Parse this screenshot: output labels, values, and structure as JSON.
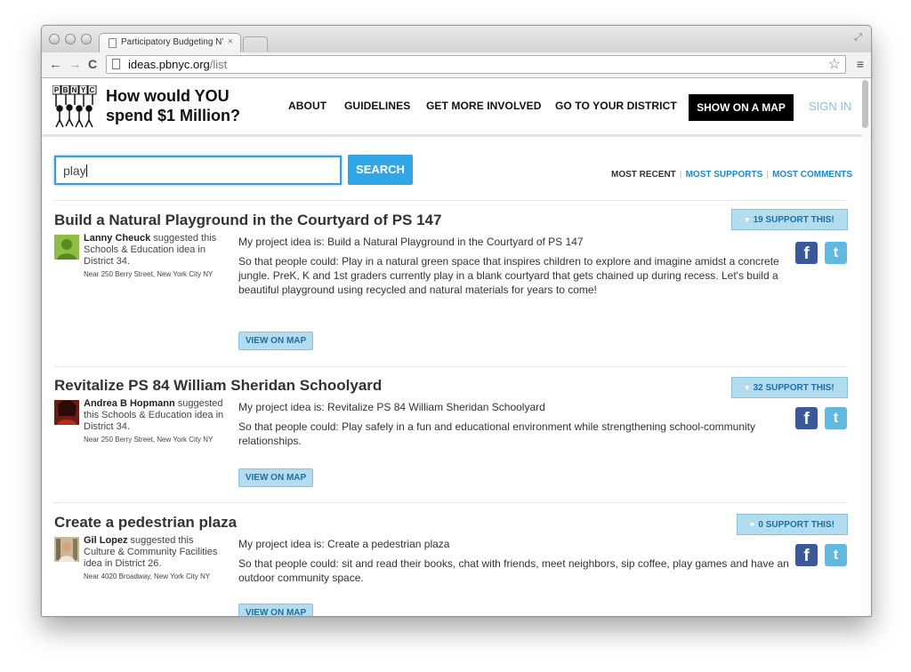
{
  "browser": {
    "tab_title": "Participatory Budgeting NY",
    "tab_close": "×",
    "url_host": "ideas.pbnyc.org",
    "url_path": "/list",
    "back": "←",
    "forward": "→",
    "reload": "C",
    "star": "☆",
    "menu": "≡"
  },
  "header": {
    "logo_letters": [
      "P",
      "B",
      "N",
      "Y",
      "C"
    ],
    "tagline": "How would YOU spend $1 Million?",
    "nav": [
      "ABOUT",
      "GUIDELINES",
      "GET MORE INVOLVED",
      "GO TO YOUR DISTRICT"
    ],
    "map_button": "SHOW ON A MAP",
    "sign_in": "SIGN IN"
  },
  "search": {
    "value": "play",
    "button": "SEARCH"
  },
  "sort": {
    "options": [
      "MOST RECENT",
      "MOST SUPPORTS",
      "MOST COMMENTS"
    ],
    "active": "MOST RECENT"
  },
  "ideas": [
    {
      "title": "Build a Natural Playground in the Courtyard of PS 147",
      "support": "19 SUPPORT THIS!",
      "author": "Lanny Cheuck",
      "category_text": " suggested this Schools & Education idea in District 34.",
      "address": "Near 250 Berry Street, New York City NY",
      "idea_line": "My project idea is: Build a Natural Playground in the Courtyard of PS 147",
      "so_that": "So that people could: Play in a natural green space that inspires children to explore and imagine amidst a concrete jungle. PreK, K and 1st graders currently play in a blank courtyard that gets chained up during recess. Let's build a beautiful playground using recycled and natural materials for years to come!",
      "map_button": "VIEW ON MAP"
    },
    {
      "title": "Revitalize PS 84 William Sheridan Schoolyard",
      "support": "32 SUPPORT THIS!",
      "author": "Andrea B Hopmann",
      "category_text": " suggested this Schools & Education idea in District 34.",
      "address": "Near 250 Berry Street, New York City NY",
      "idea_line": "My project idea is: Revitalize PS 84 William Sheridan Schoolyard",
      "so_that": "So that people could: Play safely in a fun and educational environment while strengthening school-community relationships.",
      "map_button": "VIEW ON MAP"
    },
    {
      "title": "Create a pedestrian plaza",
      "support": "0 SUPPORT THIS!",
      "author": "Gil Lopez",
      "category_text": " suggested this Culture & Community Facilities idea in District 26.",
      "address": "Near 4020 Broadway, New York City NY",
      "idea_line": "My project idea is: Create a pedestrian plaza",
      "so_that": "So that people could: sit and read their books, chat with friends, meet neighbors, sip coffee, play games and have an outdoor community space.",
      "map_button": "VIEW ON MAP"
    }
  ],
  "share": {
    "facebook": "f",
    "twitter": "t"
  }
}
